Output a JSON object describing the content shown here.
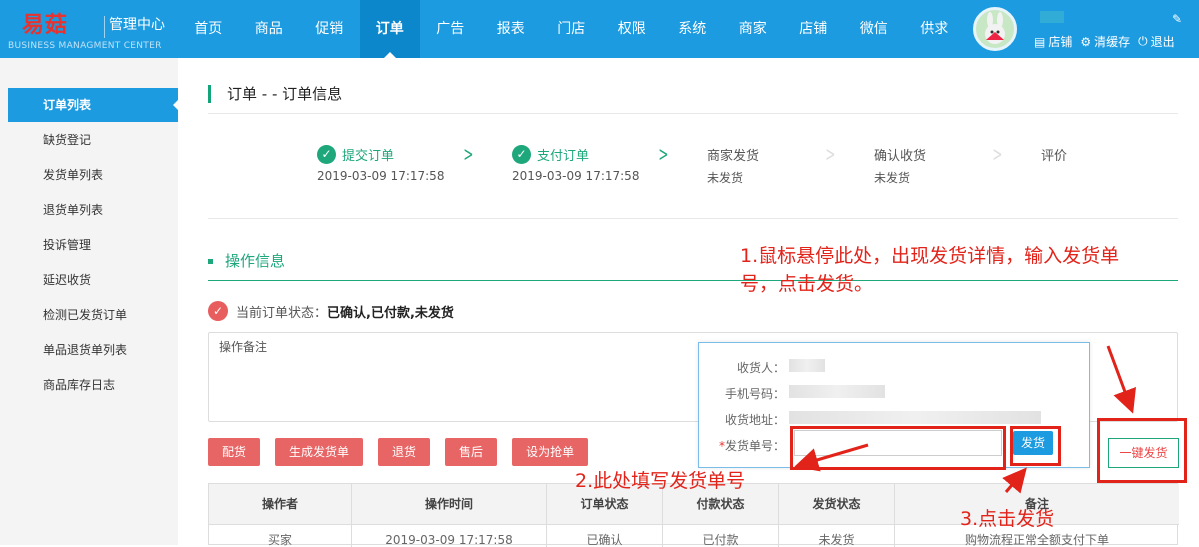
{
  "header": {
    "brand": "易菇",
    "brand_sub": "管理中心",
    "brand_en": "BUSINESS MANAGMENT CENTER",
    "nav": [
      "首页",
      "商品",
      "促销",
      "订单",
      "广告",
      "报表",
      "门店",
      "权限",
      "系统",
      "商家",
      "店铺",
      "微信",
      "供求"
    ],
    "active_nav": "订单",
    "links": {
      "store": "店铺",
      "clear_cache": "清缓存",
      "logout": "退出"
    }
  },
  "sidebar": {
    "items": [
      "订单列表",
      "缺货登记",
      "发货单列表",
      "退货单列表",
      "投诉管理",
      "延迟收货",
      "检测已发货订单",
      "单品退货单列表",
      "商品库存日志"
    ],
    "active": "订单列表"
  },
  "page": {
    "title": "订单 - - 订单信息"
  },
  "steps": [
    {
      "label": "提交订单",
      "sub": "2019-03-09 17:17:58",
      "done": true
    },
    {
      "label": "支付订单",
      "sub": "2019-03-09 17:17:58",
      "done": true
    },
    {
      "label": "商家发货",
      "sub": "未发货",
      "done": false
    },
    {
      "label": "确认收货",
      "sub": "未发货",
      "done": false
    },
    {
      "label": "评价",
      "sub": "",
      "done": false
    }
  ],
  "ops": {
    "heading": "操作信息",
    "status_label": "当前订单状态：",
    "status_value": "已确认,已付款,未发货",
    "note_placeholder": "操作备注",
    "buttons": [
      "配货",
      "生成发货单",
      "退货",
      "售后",
      "设为抢单"
    ],
    "one_key": "一键发货"
  },
  "popup": {
    "receiver_label": "收货人：",
    "phone_label": "手机号码：",
    "address_label": "收货地址：",
    "tracking_label": "发货单号：",
    "required_mark": "*",
    "send_button": "发货"
  },
  "table": {
    "headers": [
      "操作者",
      "操作时间",
      "订单状态",
      "付款状态",
      "发货状态",
      "备注"
    ],
    "row": [
      "买家",
      "2019-03-09 17:17:58",
      "已确认",
      "已付款",
      "未发货",
      "购物流程正常全额支付下单"
    ]
  },
  "annotations": {
    "a1": "1.鼠标悬停此处，出现发货详情，输入发货单",
    "a1b": "号，点击发货。",
    "a2": "2.此处填写发货单号",
    "a3": "3.点击发货"
  },
  "colors": {
    "primary": "#1d9be0",
    "green": "#1da77b",
    "red": "#e86565",
    "annotation": "#e2231a"
  }
}
